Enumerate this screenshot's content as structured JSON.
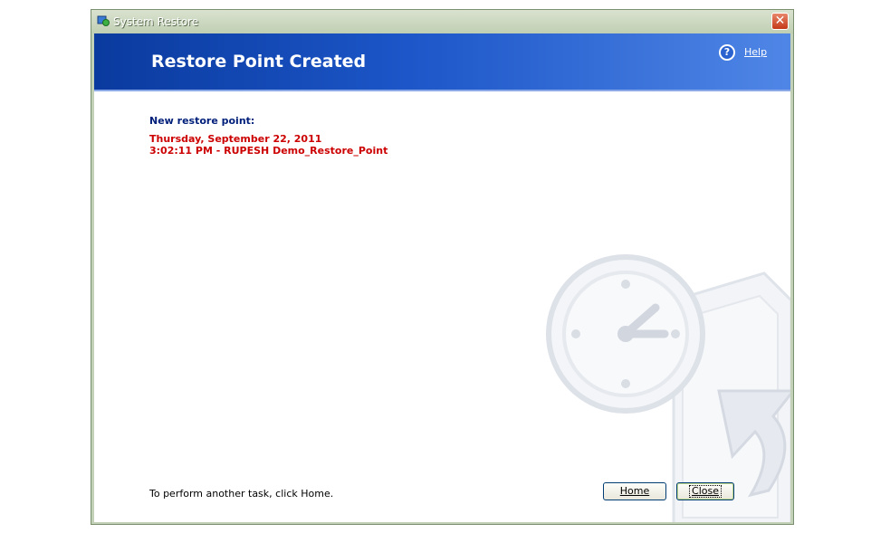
{
  "window": {
    "title": "System Restore",
    "close_glyph": "✕"
  },
  "header": {
    "title": "Restore Point Created",
    "help_icon": "?",
    "help_label": "Help"
  },
  "content": {
    "new_point_label": "New restore point:",
    "date": "Thursday, September 22, 2011",
    "detail": "3:02:11 PM - RUPESH  Demo_Restore_Point",
    "footer_text": "To perform another task, click Home."
  },
  "buttons": {
    "home_label": "Home",
    "close_label": "Close"
  },
  "colors": {
    "header_start": "#0a3a9e",
    "header_end": "#4f86e6",
    "label_blue": "#001f7a",
    "accent_red": "#cc0000"
  },
  "icons": {
    "title": "system-restore-icon",
    "help": "help-icon",
    "watermark": "clock-restore-watermark"
  }
}
